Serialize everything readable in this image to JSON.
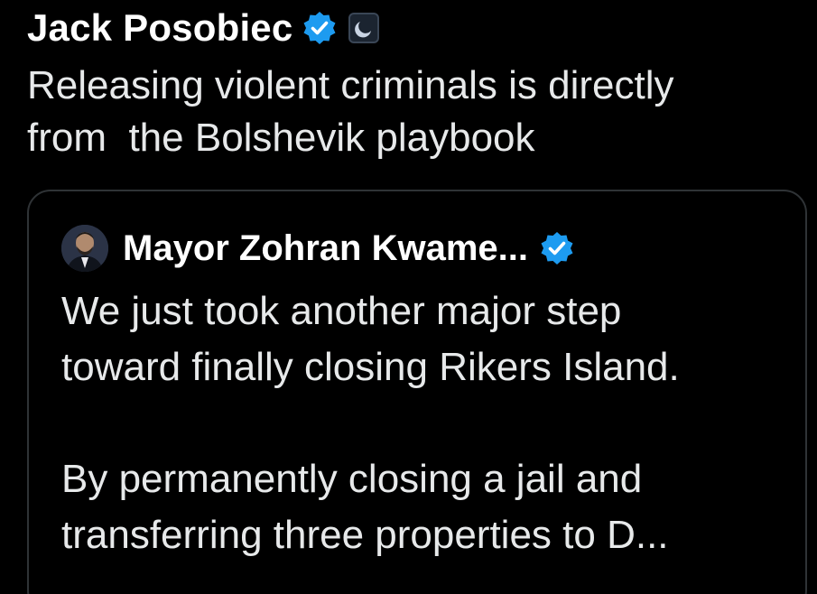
{
  "post": {
    "author_name": "Jack Posobiec",
    "text": "Releasing violent criminals is directly\nfrom  the Bolshevik playbook"
  },
  "quoted_post": {
    "author_name": "Mayor Zohran Kwame...",
    "text": "We just took another major step\ntoward finally closing Rikers Island.\n\nBy permanently closing a jail and\ntransferring three properties to D..."
  },
  "colors": {
    "background": "#000000",
    "text": "#e7e9ea",
    "verified_blue": "#1d9bf0",
    "card_border": "#2f3336"
  },
  "icons": {
    "verified": "verified-badge-icon",
    "affiliation": "affiliation-badge-icon",
    "avatar": "avatar"
  }
}
